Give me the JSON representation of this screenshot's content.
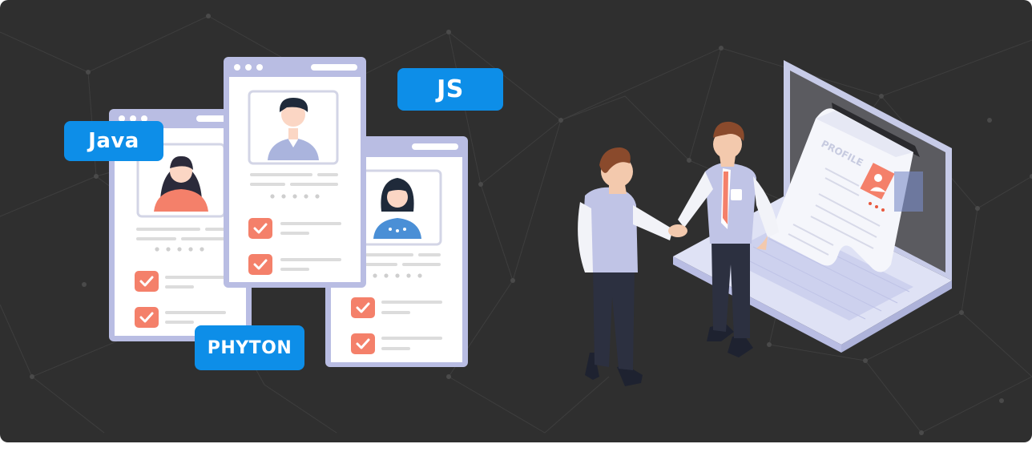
{
  "tags": {
    "java": "Java",
    "js": "JS",
    "python": "PHYTON"
  },
  "laptop": {
    "document_title": "PROFILE"
  },
  "colors": {
    "background": "#2f2f2f",
    "tag_blue": "#0d8ee8",
    "card_frame": "#b9bde3",
    "check_orange": "#f4806a",
    "stars_red": "#e8583e"
  }
}
